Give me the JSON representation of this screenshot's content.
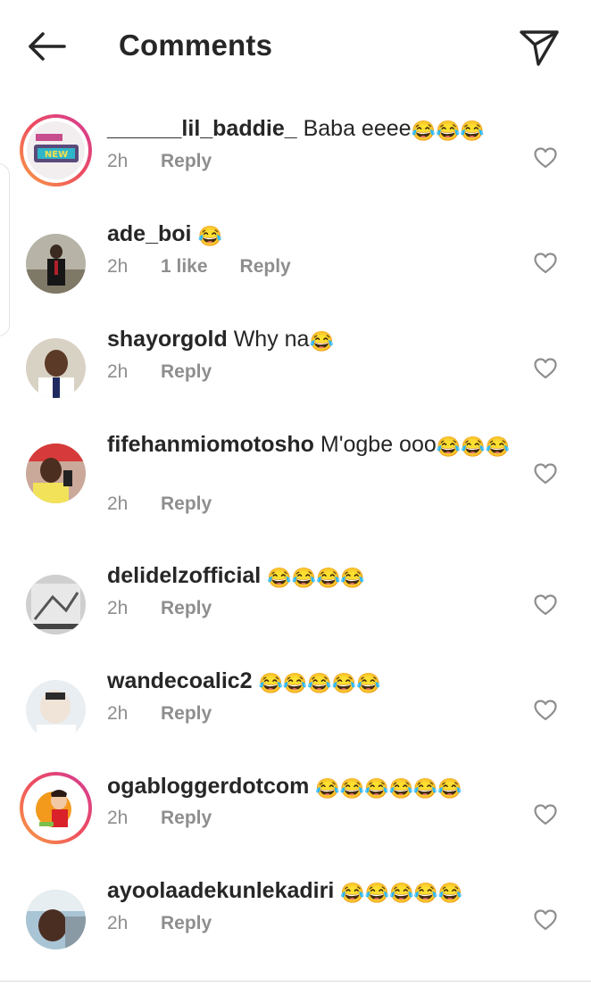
{
  "header": {
    "title": "Comments",
    "back_icon": "arrow-left-icon",
    "send_icon": "paper-plane-icon"
  },
  "colors": {
    "text": "#262626",
    "meta": "#8e8e8e",
    "story_ring": [
      "#f9a242",
      "#ee4d5f",
      "#d23b97"
    ]
  },
  "comments": [
    {
      "username": "______lil_baddie_",
      "text": "Baba eeee",
      "emoji": "😂😂😂",
      "time": "2h",
      "likes": "",
      "reply": "Reply",
      "story_ring": true
    },
    {
      "username": "ade_boi",
      "text": "",
      "emoji": "😂",
      "time": "2h",
      "likes": "1 like",
      "reply": "Reply",
      "story_ring": false
    },
    {
      "username": "shayorgold",
      "text": "Why na",
      "emoji": "😂",
      "time": "2h",
      "likes": "",
      "reply": "Reply",
      "story_ring": false
    },
    {
      "username": "fifehanmiomotosho",
      "text": "M'ogbe ooo",
      "emoji": "😂😂😂",
      "time": "2h",
      "likes": "",
      "reply": "Reply",
      "story_ring": false
    },
    {
      "username": "delidelzofficial",
      "text": "",
      "emoji": "😂😂😂😂",
      "time": "2h",
      "likes": "",
      "reply": "Reply",
      "story_ring": false
    },
    {
      "username": "wandecoalic2",
      "text": "",
      "emoji": "😂😂😂😂😂",
      "time": "2h",
      "likes": "",
      "reply": "Reply",
      "story_ring": false
    },
    {
      "username": "ogabloggerdotcom",
      "text": "",
      "emoji": "😂😂😂😂😂😂",
      "time": "2h",
      "likes": "",
      "reply": "Reply",
      "story_ring": true
    },
    {
      "username": "ayoolaadekunlekadiri",
      "text": "",
      "emoji": "😂😂😂😂😂",
      "time": "2h",
      "likes": "",
      "reply": "Reply",
      "story_ring": false
    }
  ]
}
